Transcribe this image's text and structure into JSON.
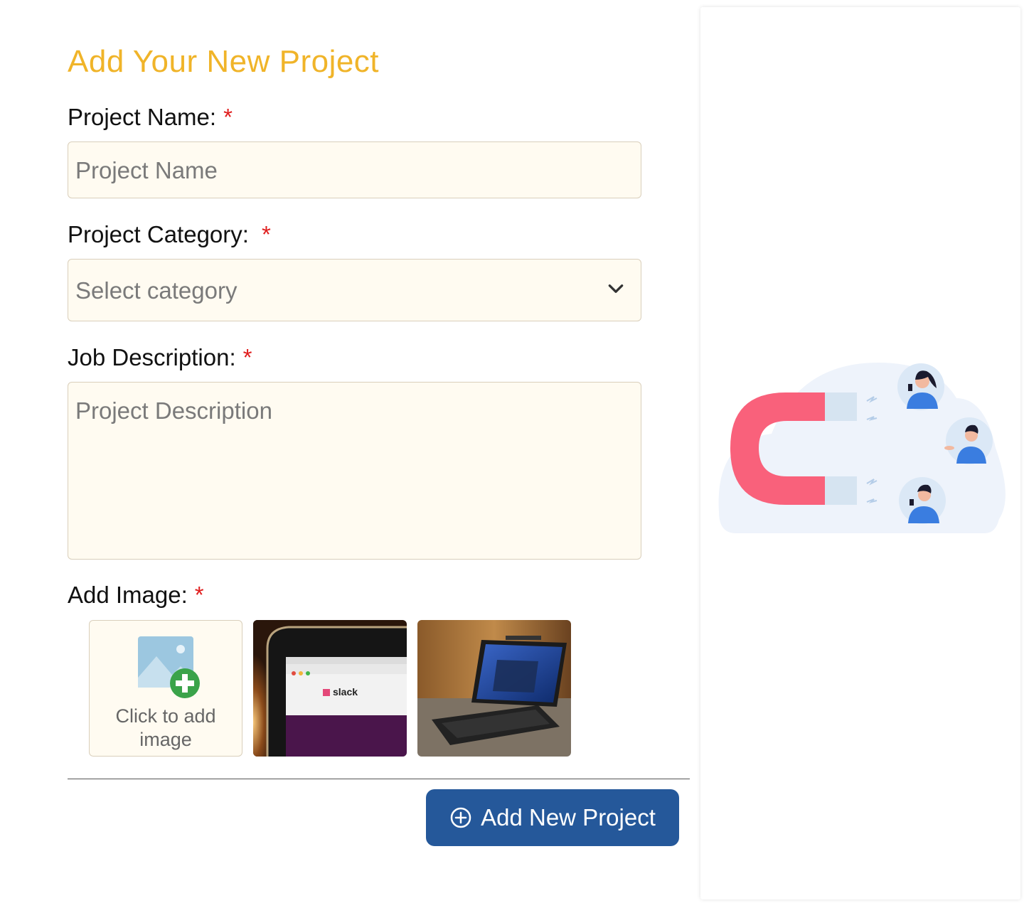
{
  "page": {
    "title": "Add Your New Project"
  },
  "form": {
    "project_name": {
      "label": "Project Name:",
      "required_mark": "*",
      "placeholder": "Project Name",
      "value": ""
    },
    "project_category": {
      "label": "Project Category:",
      "required_mark": "*",
      "selected": "Select category"
    },
    "job_description": {
      "label": "Job Description:",
      "required_mark": "*",
      "placeholder": "Project Description",
      "value": ""
    },
    "images": {
      "label": "Add Image:",
      "required_mark": "*",
      "add_text": "Click to add image",
      "thumbnails": [
        "laptop-slack-photo",
        "tablet-laptop-photo"
      ]
    },
    "submit_label": "Add New Project"
  },
  "colors": {
    "title": "#f0b429",
    "required": "#e01e1e",
    "input_bg": "#fffbf1",
    "button_bg": "#25589a"
  },
  "icons": [
    "chevron-down-icon",
    "image-add-icon",
    "plus-circle-icon",
    "magnet-illustration"
  ]
}
